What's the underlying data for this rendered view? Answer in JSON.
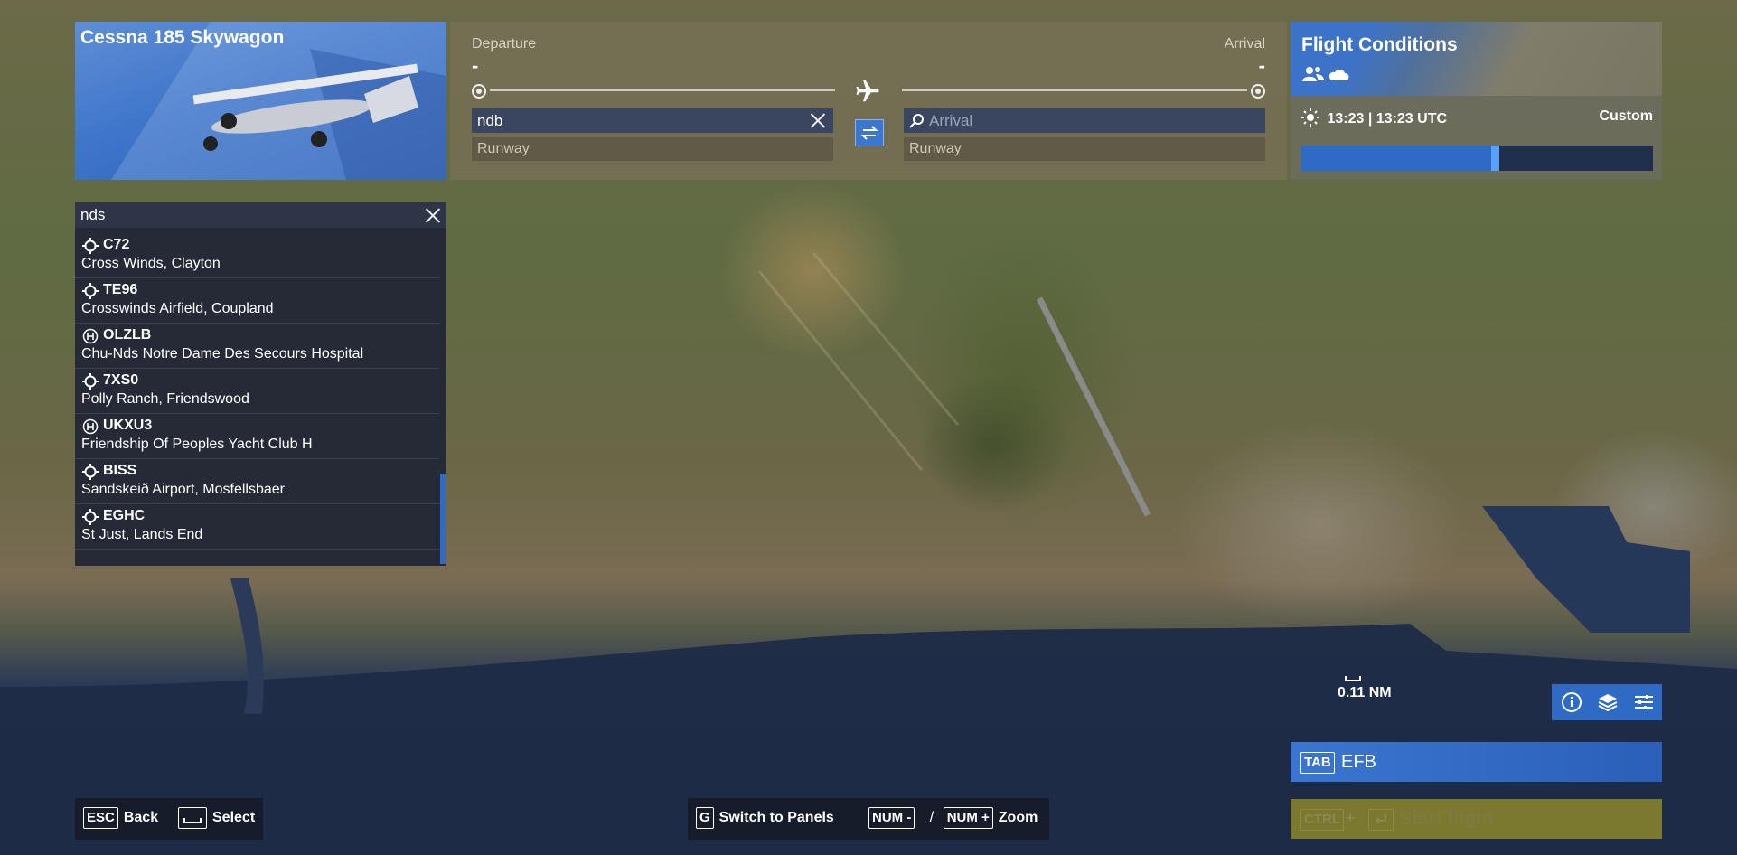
{
  "aircraft": {
    "name": "Cessna 185 Skywagon"
  },
  "route": {
    "departure_label": "Departure",
    "departure_value": "-",
    "arrival_label": "Arrival",
    "arrival_value": "-",
    "departure_search_value": "ndb",
    "arrival_search_placeholder": "Arrival",
    "departure_runway": "Runway",
    "arrival_runway": "Runway"
  },
  "conditions": {
    "title": "Flight Conditions",
    "time_local": "13:23",
    "time_separator": "|",
    "time_utc": "13:23 UTC",
    "mode": "Custom",
    "time_progress": 0.55
  },
  "search": {
    "query": "nds",
    "results": [
      {
        "code": "C72",
        "name": "Cross Winds, Clayton",
        "icon": "airport-icon"
      },
      {
        "code": "TE96",
        "name": "Crosswinds Airfield, Coupland",
        "icon": "airport-icon"
      },
      {
        "code": "OLZLB",
        "name": "Chu-Nds Notre Dame Des Secours Hospital",
        "icon": "heliport-icon"
      },
      {
        "code": "7XS0",
        "name": "Polly Ranch, Friendswood",
        "icon": "airport-icon"
      },
      {
        "code": "UKXU3",
        "name": "Friendship Of Peoples Yacht Club H",
        "icon": "heliport-icon"
      },
      {
        "code": "BISS",
        "name": "Sandskeið Airport, Mosfellsbaer",
        "icon": "airport-icon"
      },
      {
        "code": "EGHC",
        "name": "St Just, Lands End",
        "icon": "airport-icon"
      }
    ]
  },
  "map": {
    "scale_label": "0.11 NM"
  },
  "map_tools": [
    "info-icon",
    "layers-icon",
    "filters-icon"
  ],
  "efb": {
    "key": "TAB",
    "label": "EFB"
  },
  "start": {
    "key1": "CTRL",
    "plus": "+",
    "label": "Start flight"
  },
  "hints_left": [
    {
      "key": "ESC",
      "label": "Back"
    },
    {
      "key": "",
      "label": "Select"
    }
  ],
  "hints_center": {
    "switch_key": "G",
    "switch_label": "Switch to Panels",
    "zoom_out_key": "NUM -",
    "slash": "/",
    "zoom_in_key": "NUM +",
    "zoom_label": "Zoom"
  },
  "colors": {
    "accent": "#2f6ac4",
    "panel_dark": "#252a36",
    "start_bg": "#a09628"
  }
}
